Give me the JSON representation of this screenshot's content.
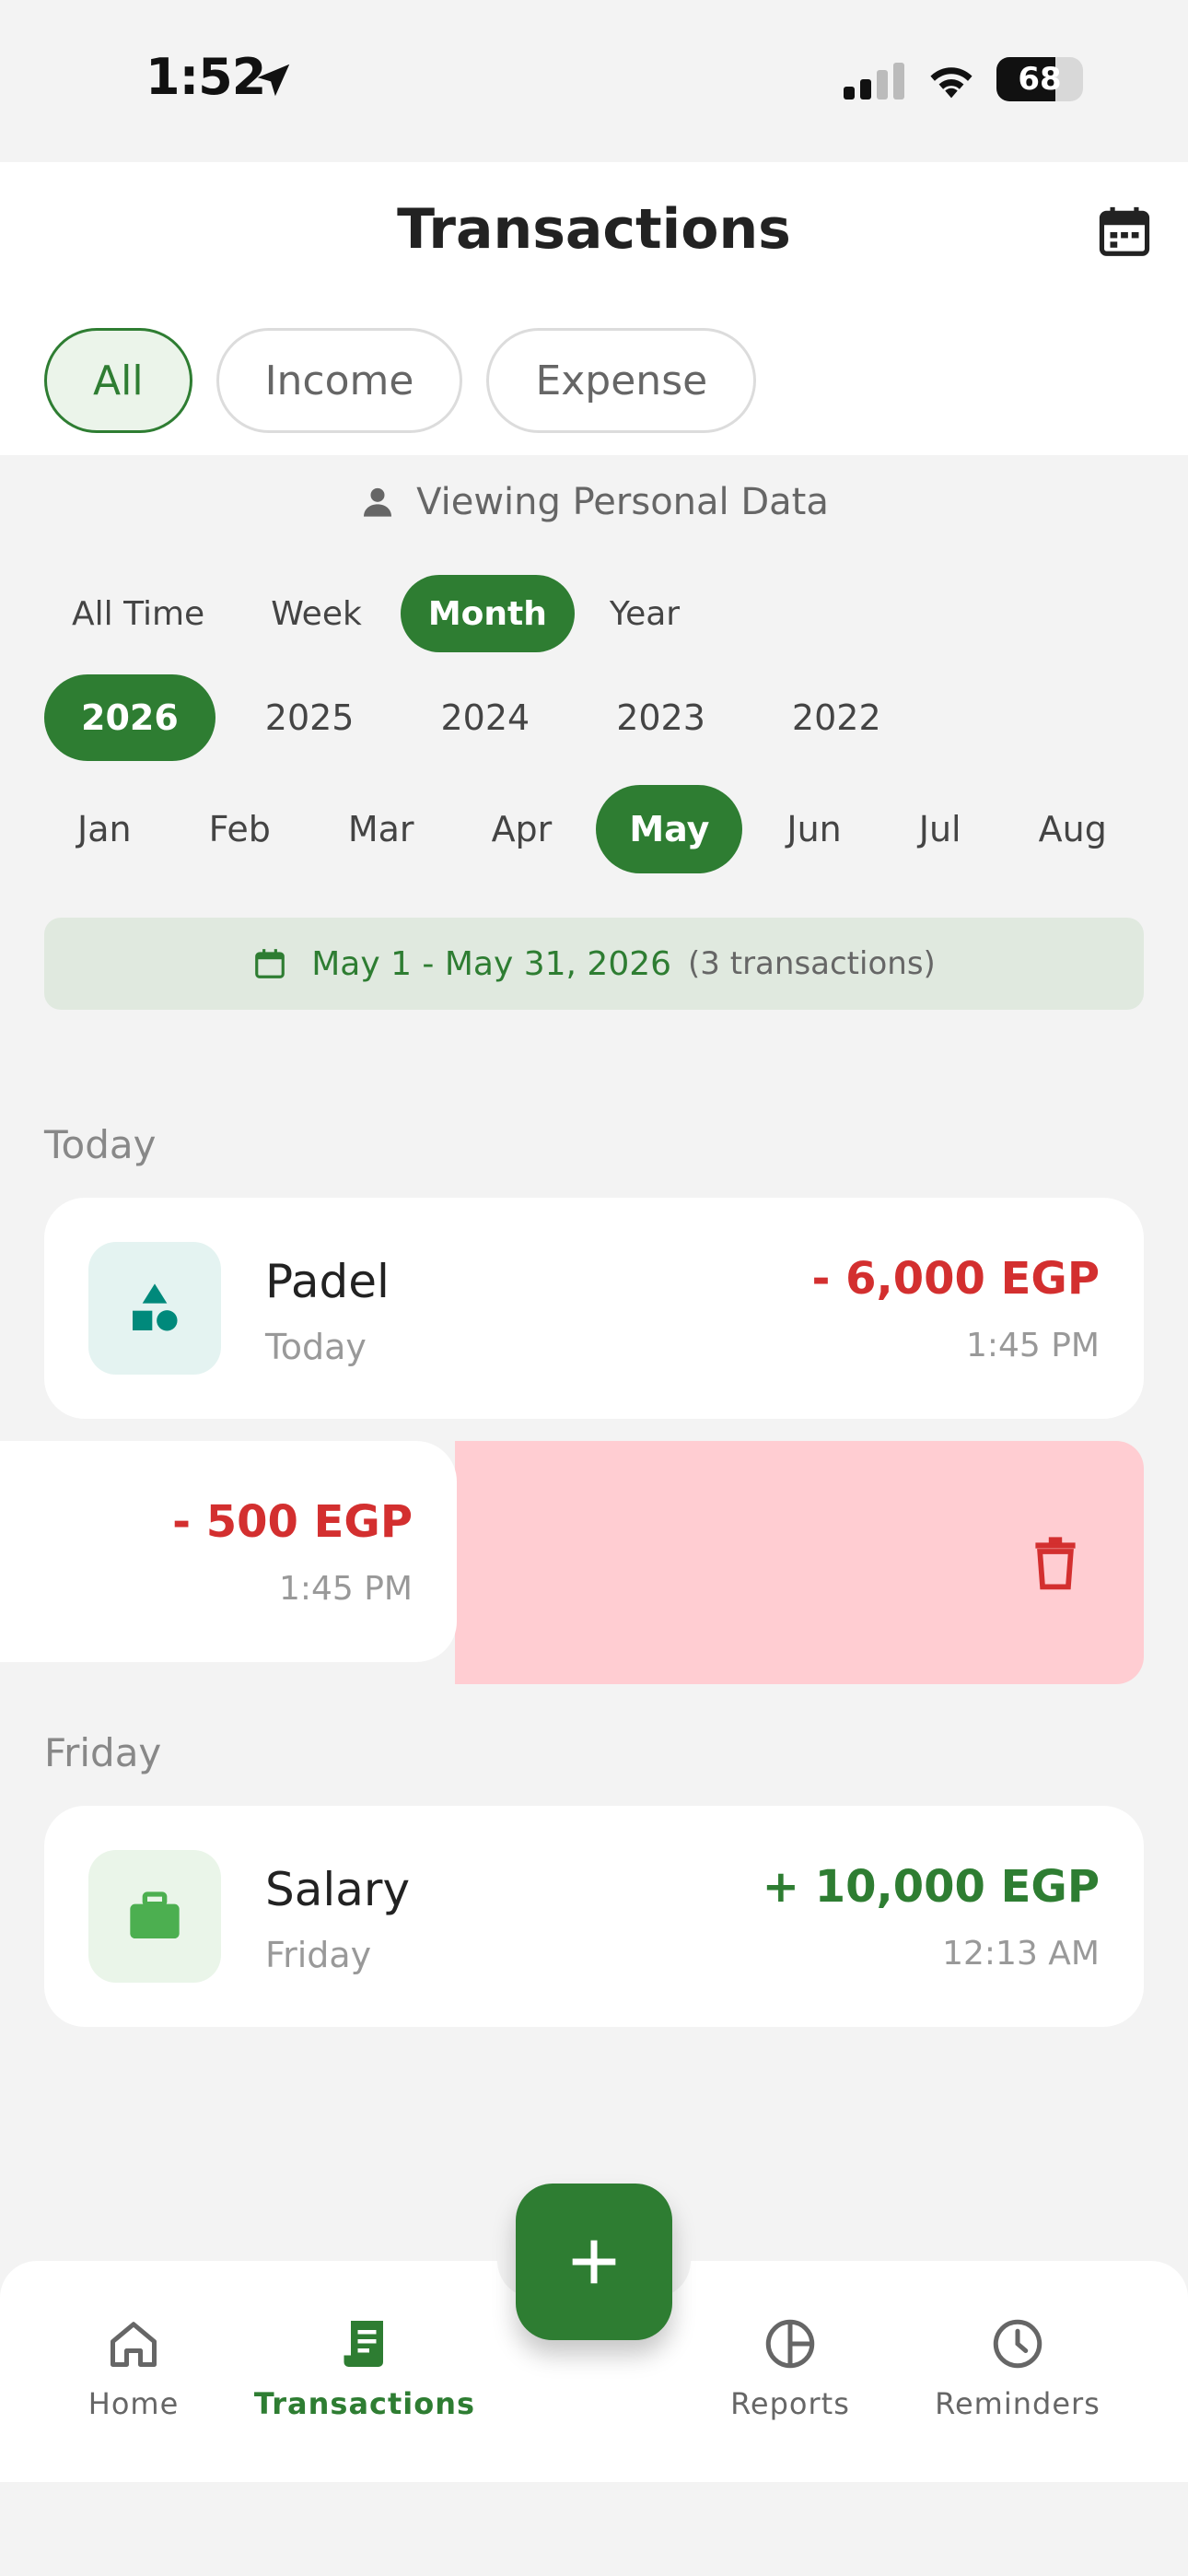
{
  "status_bar": {
    "time": "1:52",
    "battery": "68"
  },
  "header": {
    "title": "Transactions",
    "type_tabs": [
      {
        "label": "All",
        "active": true
      },
      {
        "label": "Income",
        "active": false
      },
      {
        "label": "Expense",
        "active": false
      }
    ]
  },
  "viewing_label": "Viewing Personal Data",
  "period_filters": [
    "All Time",
    "Week",
    "Month",
    "Year"
  ],
  "period_selected": "Month",
  "years": [
    "2026",
    "2025",
    "2024",
    "2023",
    "2022"
  ],
  "year_selected": "2026",
  "months": [
    "Jan",
    "Feb",
    "Mar",
    "Apr",
    "May",
    "Jun",
    "Jul",
    "Aug"
  ],
  "month_selected": "May",
  "range": {
    "text": "May 1 - May 31, 2026",
    "count": "(3 transactions)"
  },
  "groups": {
    "today": {
      "label": "Today",
      "padel": {
        "name": "Padel",
        "date": "Today",
        "amount": "- 6,000 EGP",
        "time": "1:45 PM",
        "icon": "shapes-icon"
      },
      "swiped": {
        "amount": "- 500 EGP",
        "time": "1:45 PM"
      }
    },
    "friday": {
      "label": "Friday",
      "salary": {
        "name": "Salary",
        "date": "Friday",
        "amount": "+ 10,000 EGP",
        "time": "12:13 AM",
        "icon": "briefcase-icon"
      }
    }
  },
  "nav": {
    "home": "Home",
    "transactions": "Transactions",
    "reports": "Reports",
    "reminders": "Reminders",
    "active": "Transactions"
  },
  "colors": {
    "accent": "#2e7d32",
    "negative": "#d32f2f",
    "delete_bg": "#ffcdd2"
  }
}
